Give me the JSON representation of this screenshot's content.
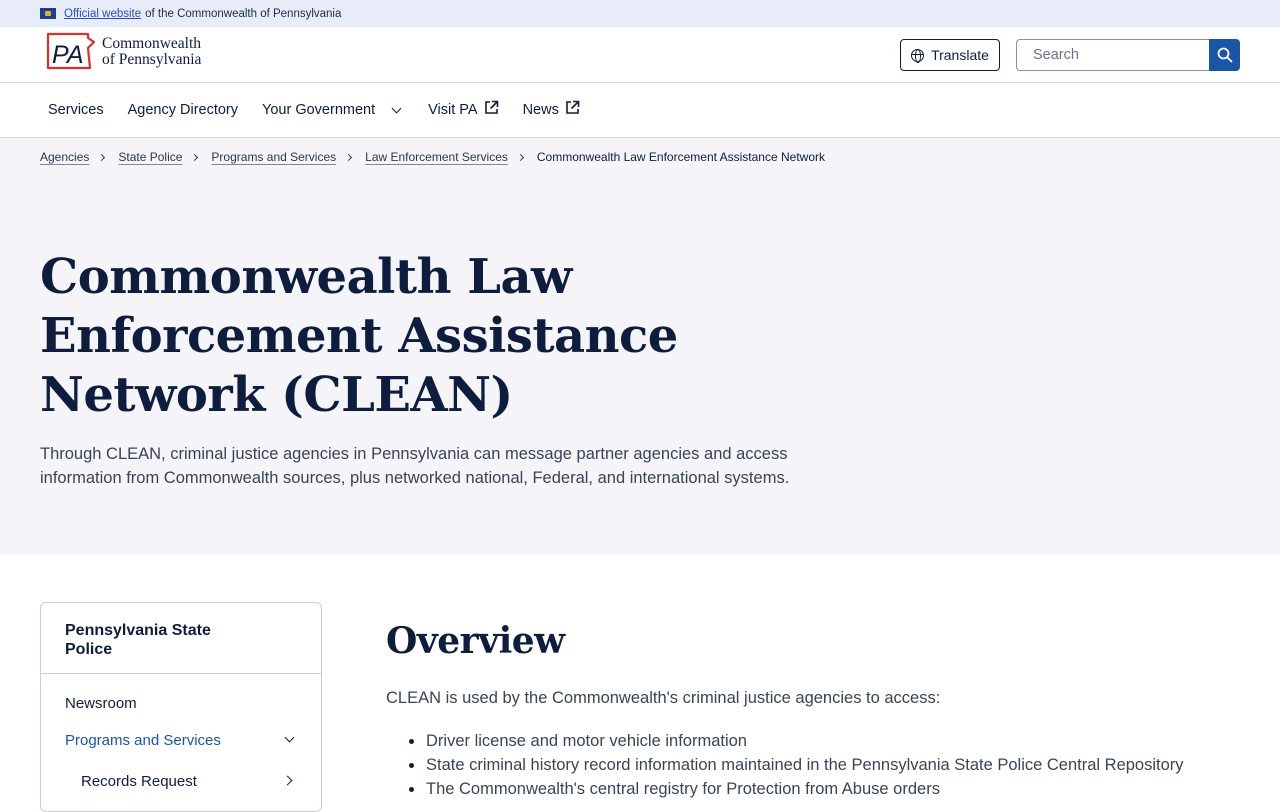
{
  "official_bar": {
    "link_text": "Official website",
    "rest_text": "of the Commonwealth of Pennsylvania"
  },
  "header": {
    "logo_mark": "PA",
    "logo_line1": "Commonwealth",
    "logo_line2": "of Pennsylvania",
    "translate_label": "Translate",
    "search_placeholder": "Search",
    "brand_color": "#1a55a6",
    "logo_red": "#d6322f"
  },
  "nav": {
    "items": [
      {
        "label": "Services"
      },
      {
        "label": "Agency Directory"
      },
      {
        "label": "Your Government"
      },
      {
        "label": "Visit PA"
      },
      {
        "label": "News"
      }
    ]
  },
  "breadcrumb": {
    "items": [
      "Agencies",
      "State Police",
      "Programs and Services",
      "Law Enforcement Services"
    ],
    "current": "Commonwealth Law Enforcement Assistance Network"
  },
  "hero": {
    "title": "Commonwealth Law Enforcement Assistance Network (CLEAN)",
    "description": "Through CLEAN, criminal justice agencies in Pennsylvania can message partner agencies and access information from Commonwealth sources, plus networked national, Federal, and international systems."
  },
  "sidebar": {
    "title": "Pennsylvania State Police",
    "items": [
      {
        "label": "Newsroom"
      },
      {
        "label": "Programs and Services"
      },
      {
        "label": "Records Request"
      }
    ]
  },
  "content": {
    "heading": "Overview",
    "intro": "CLEAN is used by the Commonwealth's criminal justice agencies to access:",
    "bullets": [
      "Driver license and motor vehicle information",
      "State criminal history record information maintained in the Pennsylvania State Police Central Repository",
      "The Commonwealth's central registry for Protection from Abuse orders"
    ]
  }
}
